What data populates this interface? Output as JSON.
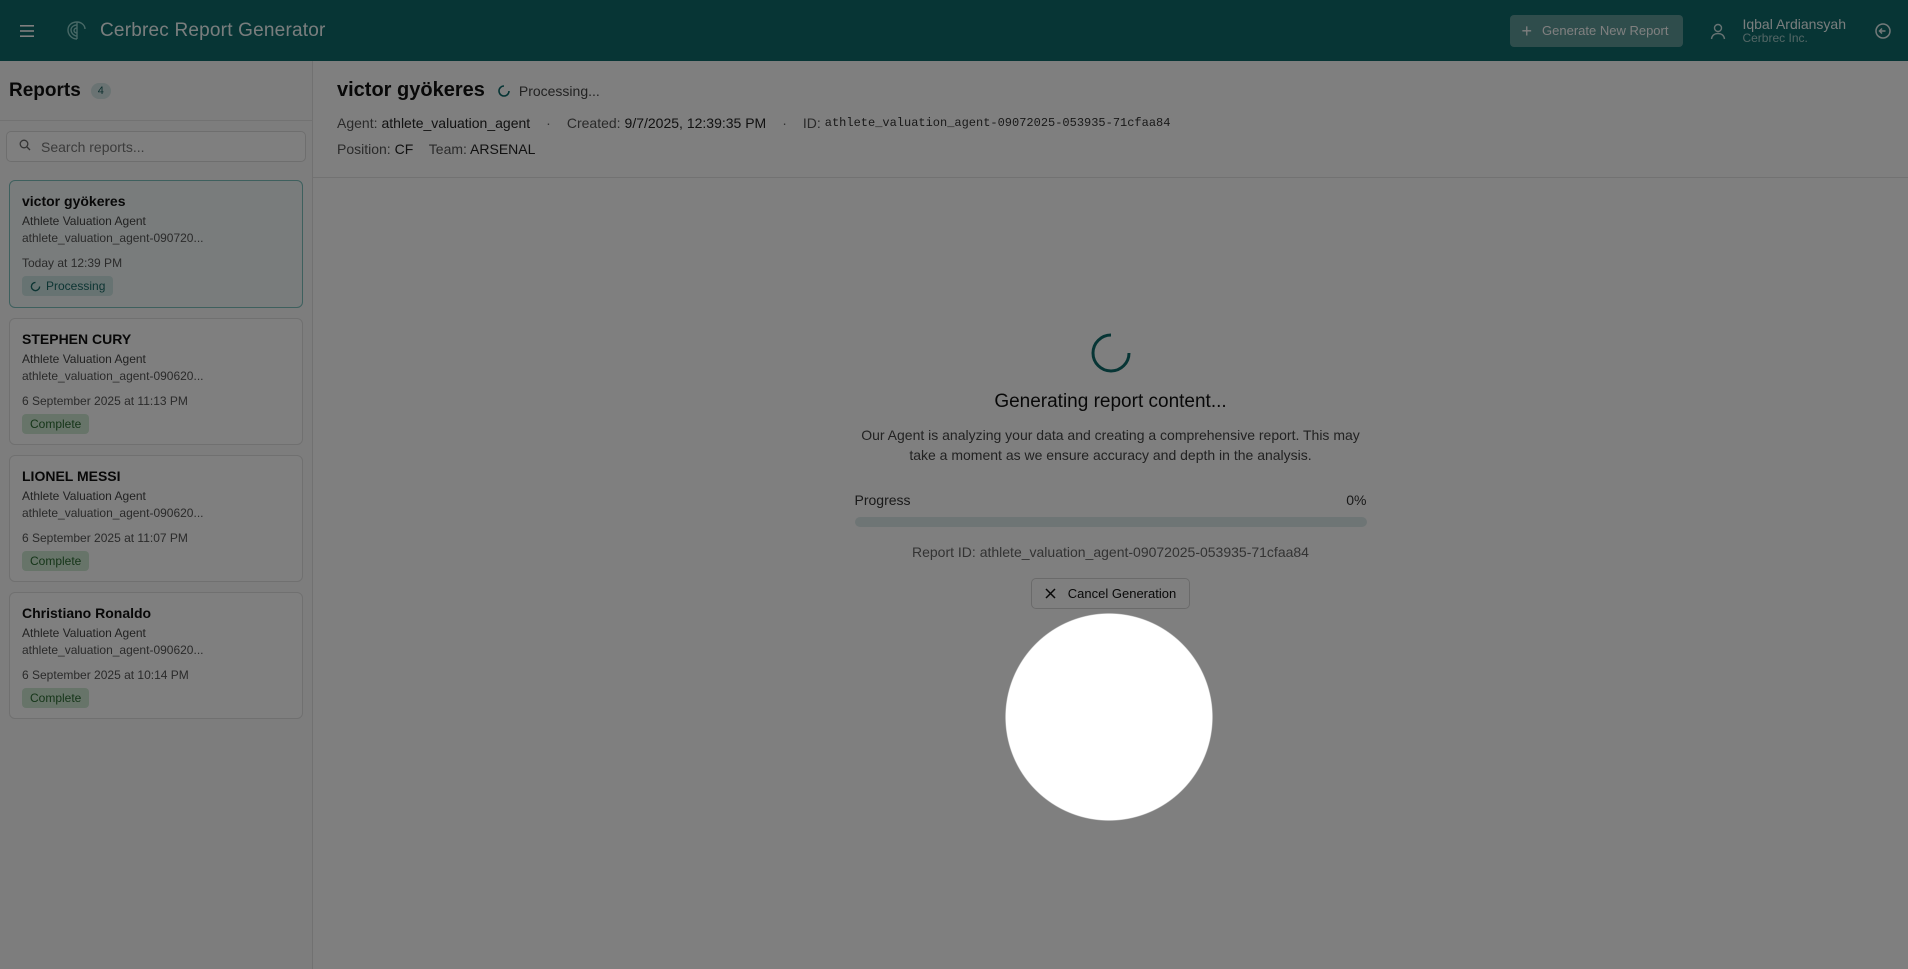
{
  "app": {
    "title": "Cerbrec Report Generator",
    "generate_button": "Generate New Report",
    "user": {
      "name": "Iqbal Ardiansyah",
      "org": "Cerbrec Inc."
    }
  },
  "sidebar": {
    "title": "Reports",
    "count": "4",
    "search_placeholder": "Search reports...",
    "reports": [
      {
        "name": "victor gyökeres",
        "agent": "Athlete Valuation Agent",
        "id": "athlete_valuation_agent-090720...",
        "date": "Today at 12:39 PM",
        "status": "Processing"
      },
      {
        "name": "STEPHEN CURY",
        "agent": "Athlete Valuation Agent",
        "id": "athlete_valuation_agent-090620...",
        "date": "6 September 2025 at 11:13 PM",
        "status": "Complete"
      },
      {
        "name": "LIONEL MESSI",
        "agent": "Athlete Valuation Agent",
        "id": "athlete_valuation_agent-090620...",
        "date": "6 September 2025 at 11:07 PM",
        "status": "Complete"
      },
      {
        "name": "Christiano Ronaldo",
        "agent": "Athlete Valuation Agent",
        "id": "athlete_valuation_agent-090620...",
        "date": "6 September 2025 at 10:14 PM",
        "status": "Complete"
      }
    ]
  },
  "main": {
    "title": "victor gyökeres",
    "status": "Processing...",
    "agent_label": "Agent:",
    "agent_value": "athlete_valuation_agent",
    "created_label": "Created:",
    "created_value": "9/7/2025, 12:39:35 PM",
    "id_label": "ID:",
    "id_value": "athlete_valuation_agent-09072025-053935-71cfaa84",
    "position_label": "Position:",
    "position_value": "CF",
    "team_label": "Team:",
    "team_value": "ARSENAL",
    "generating_title": "Generating report content...",
    "generating_desc": "Our Agent is analyzing your data and creating a comprehensive report. This may take a moment as we ensure accuracy and depth in the analysis.",
    "progress_label": "Progress",
    "progress_text": "0%",
    "progress_fraction": 0,
    "report_id_line": "Report ID: athlete_valuation_agent-09072025-053935-71cfaa84",
    "cancel_button": "Cancel Generation"
  },
  "colors": {
    "brand": "#0e6a6a",
    "processing_badge": "#cfe6e4",
    "complete_badge": "#cfe9d3"
  }
}
